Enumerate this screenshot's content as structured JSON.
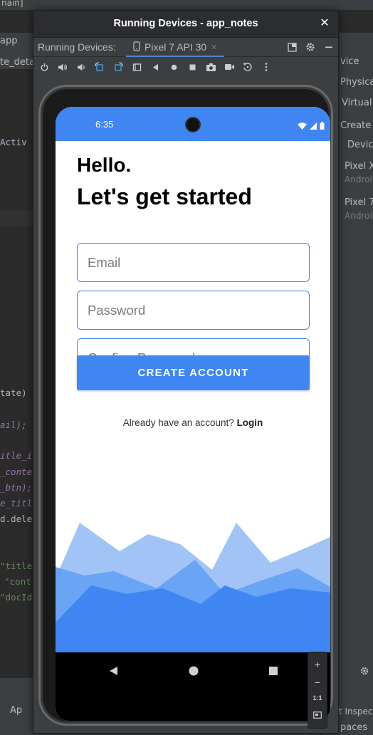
{
  "ide": {
    "top_fragment": "nain]",
    "app_select": "app",
    "editor_tab_fragment": "te_deta",
    "code_lines": [
      {
        "text": "Activ",
        "color": "#a9b7c6"
      },
      {
        "text": "tate)",
        "color": "#a9b7c6"
      },
      {
        "text": "ail);",
        "color": "#9876aa"
      },
      {
        "text": "itle_i",
        "color": "#9876aa"
      },
      {
        "text": "_conte",
        "color": "#9876aa"
      },
      {
        "text": "_btn);",
        "color": "#9876aa"
      },
      {
        "text": "e_titl",
        "color": "#9876aa"
      },
      {
        "text": "d.dele",
        "color": "#a9b7c6"
      },
      {
        "text": "\"title",
        "color": "#6a8759"
      },
      {
        "text": "\"cont",
        "color": "#6a8759"
      },
      {
        "text": "\"docId",
        "color": "#6a8759"
      }
    ],
    "right_panel": {
      "header": "vice",
      "physical_tab": "Physical",
      "virtual_tab": "Virtual",
      "create_label": "Create D",
      "devices_header": "Devic",
      "devices": [
        {
          "name": "Pixel X",
          "sub": "Androi"
        },
        {
          "name": "Pixel 7",
          "sub": "Androi"
        }
      ]
    },
    "bottom_left": "Ap",
    "bottom_right_1": "t Inspect",
    "bottom_right_2": "paces"
  },
  "window": {
    "title": "Running Devices - app_notes",
    "close_label": "✕",
    "tabbar_label": "Running Devices:",
    "tab_label": "Pixel 7 API 30",
    "tab_close": "✕"
  },
  "phone": {
    "status_time": "6:35",
    "heading_1": "Hello.",
    "heading_2": "Let's get started",
    "email_placeholder": "Email",
    "password_placeholder": "Password",
    "confirm_placeholder": "Confirm Password",
    "create_button": "CREATE ACCOUNT",
    "login_prompt": "Already have an account?",
    "login_link": "Login"
  },
  "zoom": {
    "zoom_in": "+",
    "zoom_out": "−",
    "actual_size": "1:1"
  },
  "colors": {
    "accent": "#3f86f2",
    "mountain_light": "#a2c3f6",
    "mountain_mid": "#6aa4f5",
    "mountain_dark": "#3f86f2"
  }
}
